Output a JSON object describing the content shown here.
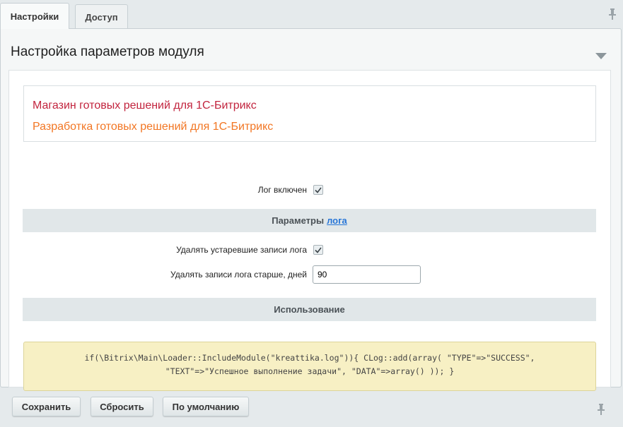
{
  "tabs": [
    {
      "label": "Настройки",
      "active": true
    },
    {
      "label": "Доступ",
      "active": false
    }
  ],
  "panel": {
    "title": "Настройка параметров модуля"
  },
  "brand": {
    "line1": "Магазин готовых решений для 1С-Битрикс",
    "line2": "Разработка готовых решений для 1С-Битрикс",
    "line1_color": "#c2243e",
    "line2_color": "#f27623"
  },
  "settings": {
    "log_enabled_label": "Лог включен",
    "log_enabled": true,
    "params_section_prefix": "Параметры",
    "params_section_link": "лога",
    "delete_old_label": "Удалять устаревшие записи лога",
    "delete_old": true,
    "delete_days_label": "Удалять записи лога старше, дней",
    "delete_days_value": "90",
    "usage_section": "Использование"
  },
  "usage_code": {
    "line1": "if(\\Bitrix\\Main\\Loader::IncludeModule(\"kreattika.log\")){ CLog::add(array( \"TYPE\"=>\"SUCCESS\",",
    "line2": "\"TEXT\"=>\"Успешное выполнение задачи\", \"DATA\"=>array() )); }"
  },
  "footer": {
    "save_label": "Сохранить",
    "reset_label": "Сбросить",
    "default_label": "По умолчанию"
  },
  "icons": {
    "pin": "pin-icon",
    "collapse": "triangle-down-icon",
    "check": "check-icon"
  },
  "colors": {
    "link": "#2675d7",
    "code_bg": "#f7f0c4"
  }
}
